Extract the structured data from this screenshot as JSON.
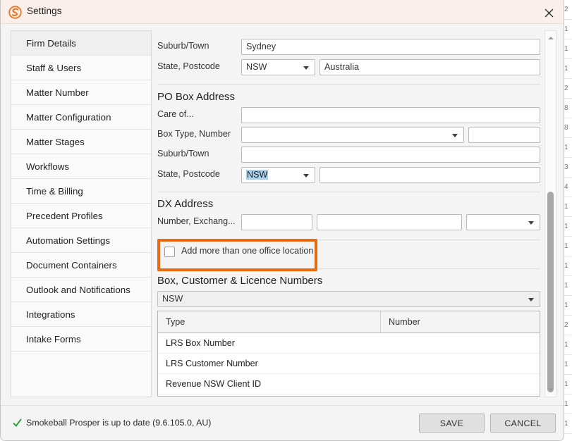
{
  "background": {
    "right_column_rows": [
      "2",
      "1",
      "1",
      "1",
      "2",
      "8",
      "8",
      "1",
      "3",
      "4",
      "1",
      "1",
      "1",
      "1",
      "1",
      "1",
      "2",
      "1",
      "1",
      "1",
      "1",
      "1"
    ]
  },
  "window": {
    "title": "Settings",
    "logo_icon": "smokeball-logo-icon",
    "close_icon": "close-icon",
    "titlebar_color": "#faefeb",
    "accent_color": "#ea6a10"
  },
  "sidebar": {
    "items": [
      {
        "label": "Firm Details",
        "selected": true
      },
      {
        "label": "Staff & Users",
        "selected": false
      },
      {
        "label": "Matter Number",
        "selected": false
      },
      {
        "label": "Matter Configuration",
        "selected": false
      },
      {
        "label": "Matter Stages",
        "selected": false
      },
      {
        "label": "Workflows",
        "selected": false
      },
      {
        "label": "Time & Billing",
        "selected": false
      },
      {
        "label": "Precedent Profiles",
        "selected": false
      },
      {
        "label": "Automation Settings",
        "selected": false
      },
      {
        "label": "Document Containers",
        "selected": false
      },
      {
        "label": "Outlook and Notifications",
        "selected": false
      },
      {
        "label": "Integrations",
        "selected": false
      },
      {
        "label": "Intake Forms",
        "selected": false
      }
    ]
  },
  "main": {
    "street_address": {
      "suburb_label": "Suburb/Town",
      "suburb_value": "Sydney",
      "state_postcode_label": "State, Postcode",
      "state_value": "NSW",
      "country_value": "Australia"
    },
    "po_box": {
      "heading": "PO Box Address",
      "care_of_label": "Care of...",
      "care_of_value": "",
      "box_type_label": "Box Type, Number",
      "box_type_value": "",
      "box_number_value": "",
      "suburb_label": "Suburb/Town",
      "suburb_value": "",
      "state_postcode_label": "State, Postcode",
      "state_value": "NSW",
      "state_value_selected": true,
      "postcode_value": ""
    },
    "dx_address": {
      "heading": "DX Address",
      "number_exchange_label": "Number, Exchang...",
      "number_value": "",
      "exchange_value": "",
      "state_value": ""
    },
    "office_locations": {
      "checkbox_label": "Add more than one office location",
      "checked": false,
      "annotated": true,
      "annotation_color": "#ea6a10"
    },
    "numbers_section": {
      "heading": "Box, Customer & Licence Numbers",
      "state_filter_value": "NSW",
      "columns": [
        "Type",
        "Number"
      ],
      "rows": [
        {
          "type": "LRS Box Number",
          "number": ""
        },
        {
          "type": "LRS Customer Number",
          "number": ""
        },
        {
          "type": "Revenue NSW Client ID",
          "number": ""
        }
      ]
    },
    "scrollbar": {
      "up_icon": "chevron-up-icon",
      "down_icon": "chevron-down-icon"
    }
  },
  "footer": {
    "status_icon": "green-check-icon",
    "status_text": "Smokeball Prosper is up to date (9.6.105.0, AU)",
    "save_label": "SAVE",
    "cancel_label": "CANCEL"
  }
}
